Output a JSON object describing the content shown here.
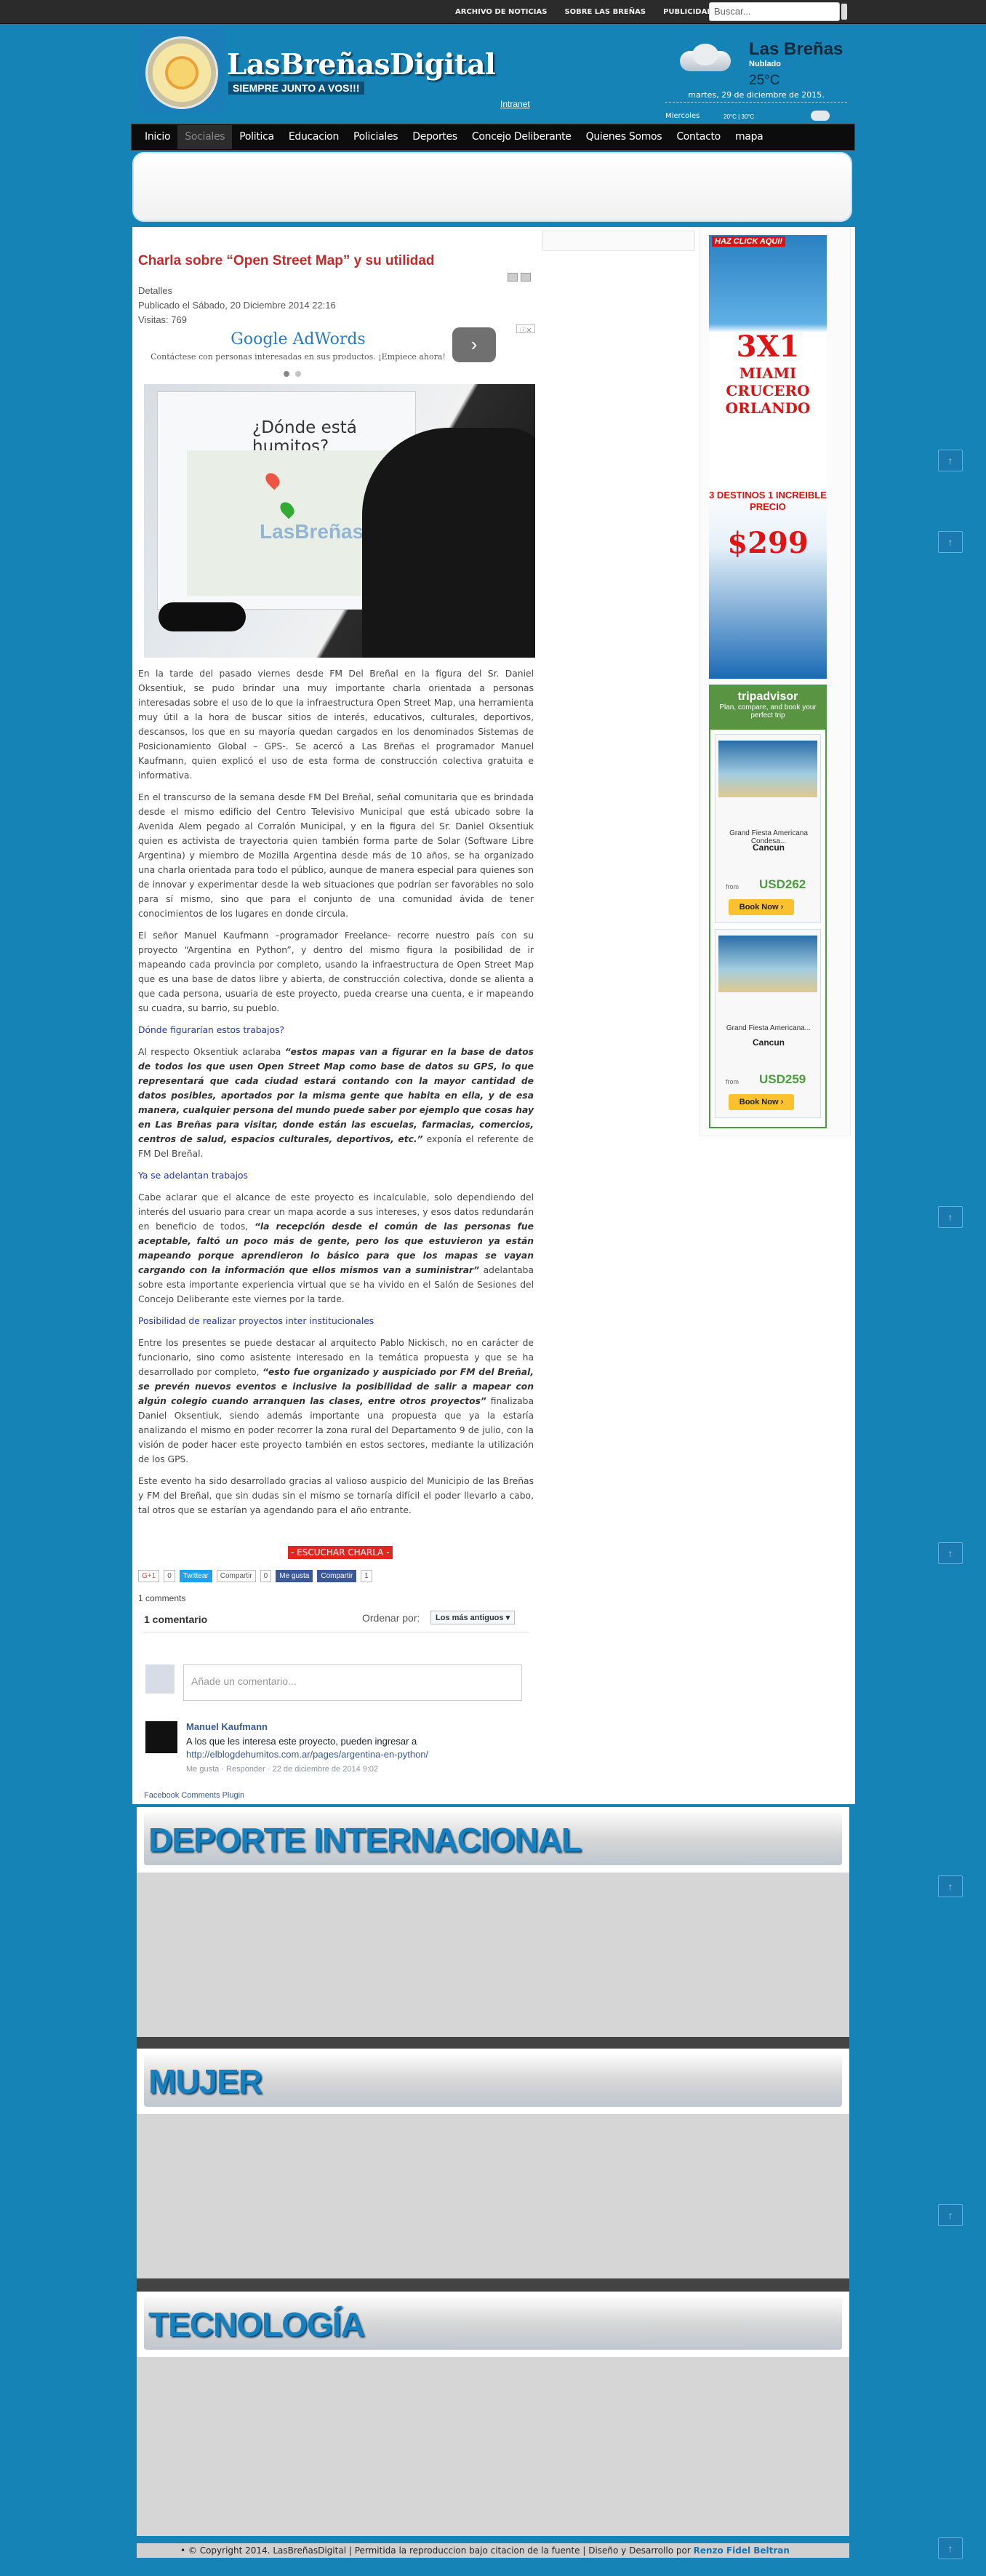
{
  "topbar": {
    "links": [
      "ARCHIVO DE NOTICIAS",
      "SOBRE LAS BREÑAS",
      "PUBLICIDAD"
    ],
    "search_placeholder": "Buscar..."
  },
  "header": {
    "site_name": "LasBreñasDigital",
    "slogan": "SIEMPRE JUNTO A VOS!!!",
    "intranet": "Intranet"
  },
  "weather": {
    "city": "Las Breñas",
    "condition": "Nublado",
    "temp": "25°C",
    "date": "martes, 29 de diciembre de 2015.",
    "day": "Miercoles",
    "range": "20°C | 30°C"
  },
  "nav": {
    "items": [
      "Inicio",
      "Sociales",
      "Politica",
      "Educacion",
      "Policiales",
      "Deportes",
      "Concejo Deliberante",
      "Quienes Somos",
      "Contacto",
      "mapa"
    ]
  },
  "article": {
    "title": "Charla sobre “Open Street Map” y su utilidad",
    "details_label": "Detalles",
    "published": "Publicado el Sábado, 20 Diciembre 2014 22:16",
    "visits": "Visitas: 769",
    "ad": {
      "title": "Google AdWords",
      "subtitle": "Contáctese con personas interesadas en sus productos. ¡Empiece ahora!",
      "button": "›"
    },
    "photo": {
      "question": "¿Dónde está humitos?",
      "watermark": "LasBreñas"
    },
    "p1": "En la tarde del pasado viernes desde FM Del Breñal en la figura del Sr. Daniel Oksentiuk, se pudo brindar una muy importante charla orientada a personas interesadas sobre el uso de lo que la infraestructura Open Street Map, una herramienta muy útil a la hora de buscar sitios de interés, educativos, culturales, deportivos, descansos, los que en su mayoría quedan cargados en los denominados Sistemas de Posicionamiento Global – GPS-. Se acercó a Las Breñas el programador Manuel Kaufmann, quien explicó el uso de esta forma de construcción colectiva gratuita e informativa.",
    "p2": "En el transcurso de la semana desde FM Del Breñal, señal comunitaria que es brindada desde el mismo edificio del Centro Televisivo Municipal que está ubicado sobre la Avenida Alem pegado al Corralón Municipal, y en la figura del Sr. Daniel Oksentiuk quien es activista de trayectoria quien también forma parte de Solar (Software Libre Argentina) y miembro de Mozilla Argentina desde más de 10 años, se ha organizado una charla orientada para todo el público, aunque de manera especial para quienes son de innovar y experimentar desde la web situaciones que podrían ser favorables no solo para sí mismo, sino que para el conjunto de una comunidad ávida de tener conocimientos de los lugares en donde circula.",
    "p3": "El señor Manuel Kaufmann –programador Freelance- recorre nuestro país con su proyecto “Argentina en Python”, y dentro del mismo figura la posibilidad de ir mapeando cada provincia por completo, usando la infraestructura de Open Street Map que es una base de datos libre y abierta, de construcción colectiva, donde se alienta a que cada persona, usuaria de este proyecto, pueda crearse una cuenta, e ir mapeando su cuadra, su barrio, su pueblo.",
    "sub1": "Dónde figurarían estos trabajos?",
    "p4a": "Al respecto Oksentiuk aclaraba ",
    "p4b": "“estos mapas van a figurar en la base de datos de todos los que usen Open Street Map como base de datos su GPS, lo que representará que cada ciudad estará contando con la mayor cantidad de datos posibles, aportados por la misma gente que habita en ella, y de esa manera, cualquier persona del mundo puede saber por ejemplo que cosas hay en Las Breñas para visitar, donde están las escuelas, farmacias, comercios, centros de salud, espacios culturales, deportivos, etc.”",
    "p4c": " exponía el referente de FM Del Breñal.",
    "sub2": "Ya se adelantan trabajos",
    "p5a": "Cabe aclarar que el alcance de este proyecto es incalculable, solo dependiendo del interés del usuario para crear un mapa acorde a sus intereses, y esos datos redundarán en beneficio de todos, ",
    "p5b": "“la recepción desde el común de las personas fue aceptable, faltó un poco más de gente, pero los que estuvieron ya están mapeando porque aprendieron lo básico para que los mapas se vayan cargando con la información que ellos mismos van a suministrar”",
    "p5c": " adelantaba sobre esta importante experiencia virtual que se ha vivido en el Salón de Sesiones del Concejo Deliberante este viernes por la tarde.",
    "sub3": "Posibilidad de realizar proyectos inter institucionales",
    "p6a": "Entre los presentes se puede destacar al arquitecto Pablo Nickisch, no en carácter de funcionario, sino como asistente interesado en la temática propuesta y que se ha desarrollado por completo, ",
    "p6b": "“esto fue organizado y auspiciado por FM del Breñal, se prevén nuevos eventos e inclusive la posibilidad de salir a mapear con algún colegio cuando arranquen las clases, entre otros proyectos”",
    "p6c": " finalizaba Daniel Oksentiuk, siendo además importante una propuesta que ya la estaría analizando el mismo en poder recorrer la zona rural del Departamento 9 de julio, con la visión de poder hacer este proyecto también en estos sectores, mediante la utilización de los GPS.",
    "p7": "Este evento ha sido desarrollado gracias al valioso auspicio del Municipio de las Breñas y FM del Breñal, que sin dudas sin el mismo se tornaría difícil el poder llevarlo a cabo, tal otros que se estarían ya agendando para el año entrante.",
    "listen": "- ESCUCHAR CHARLA -",
    "share": [
      "G+1",
      "0",
      "Twittear",
      "Compartir",
      "0",
      "Me gusta",
      "Compartir",
      "1"
    ],
    "comments_count": "1 comments"
  },
  "fb_comments": {
    "count_label": "1 comentario",
    "order_label": "Ordenar por:",
    "order_value": "Los más antiguos ▾",
    "input_placeholder": "Añade un comentario...",
    "comment": {
      "author": "Manuel Kaufmann",
      "text": "A los que les interesa este proyecto, pueden ingresar a",
      "link": "http://elblogdehumitos.com.ar/pages/argentina-en-python/",
      "meta": "Me gusta · Responder · 22 de diciembre de 2014 9:02"
    },
    "plugin": "Facebook Comments Plugin"
  },
  "ads": {
    "cruise": {
      "tag": "HAZ CLICK AQUI!",
      "big": "3X1",
      "lines": [
        "MIAMI",
        "CRUCERO",
        "ORLANDO"
      ],
      "dest": "3 DESTINOS 1 INCREIBLE PRECIO",
      "price": "$299"
    },
    "tripadvisor": {
      "brand": "tripadvisor",
      "tagline": "Plan, compare, and book your perfect trip",
      "cards": [
        {
          "name": "Grand Fiesta Americana Condesa...",
          "city": "Cancun",
          "from": "from",
          "price": "USD262",
          "book": "Book Now ›"
        },
        {
          "name": "Grand Fiesta Americana...",
          "city": "Cancun",
          "from": "from",
          "price": "USD259",
          "book": "Book Now ›"
        }
      ]
    }
  },
  "sections": [
    "DEPORTE INTERNACIONAL",
    "MUJER",
    "TECNOLOGÍA"
  ],
  "footer": {
    "text": "• © Copyright 2014. LasBreñasDigital | Permitida la reproduccion bajo citacion de la fuente | Diseño y Desarrollo por ",
    "author": "Renzo Fidel Beltran"
  },
  "scroll_top_icon": "↑"
}
